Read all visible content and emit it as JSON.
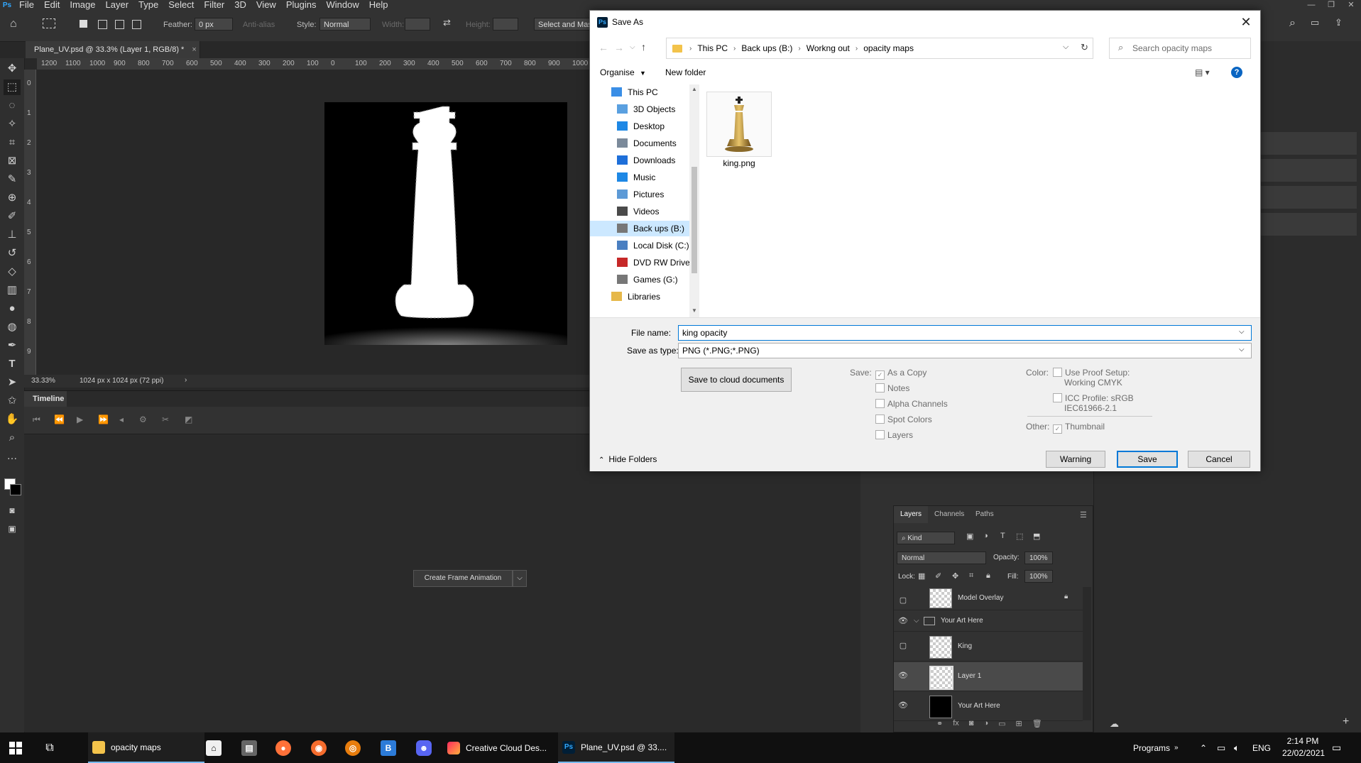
{
  "app": {
    "logo": "Ps",
    "menu": [
      "File",
      "Edit",
      "Image",
      "Layer",
      "Type",
      "Select",
      "Filter",
      "3D",
      "View",
      "Plugins",
      "Window",
      "Help"
    ],
    "window_controls": [
      "—",
      "❐",
      "✕"
    ]
  },
  "options_bar": {
    "feather_label": "Feather:",
    "feather_value": "0 px",
    "antialias_label": "Anti-alias",
    "style_label": "Style:",
    "style_value": "Normal",
    "width_label": "Width:",
    "height_label": "Height:",
    "select_mask_label": "Select and Mask..."
  },
  "document": {
    "tab_title": "Plane_UV.psd @ 33.3% (Layer 1, RGB/8) *",
    "tab_close": "×",
    "zoom": "33.33%",
    "doc_size": "1024 px x 1024 px (72 ppi)",
    "ruler_top": [
      "1200",
      "1100",
      "1000",
      "900",
      "800",
      "700",
      "600",
      "500",
      "400",
      "300",
      "200",
      "100",
      "0",
      "100",
      "200",
      "300",
      "400",
      "500",
      "600",
      "700",
      "800",
      "900",
      "1000"
    ],
    "ruler_left": [
      "0",
      "1",
      "2",
      "3",
      "4",
      "5",
      "6",
      "7",
      "8",
      "9"
    ]
  },
  "timeline": {
    "tab_label": "Timeline",
    "create_button": "Create Frame Animation",
    "dropdown_arrow": "⌵"
  },
  "layers_panel": {
    "tabs": [
      "Layers",
      "Channels",
      "Paths"
    ],
    "kind_value": "Kind",
    "blend_mode": "Normal",
    "opacity_label": "Opacity:",
    "opacity_value": "100%",
    "lock_label": "Lock:",
    "fill_label": "Fill:",
    "fill_value": "100%",
    "layers": [
      {
        "name": "Model Overlay",
        "visible": false
      },
      {
        "name": "Your Art Here",
        "visible": true,
        "group": true
      },
      {
        "name": "King",
        "visible": false
      },
      {
        "name": "Layer 1",
        "visible": true,
        "selected": true
      },
      {
        "name": "Your Art Here",
        "visible": true
      }
    ]
  },
  "dialog": {
    "icon": "Ps",
    "title": "Save As",
    "close": "✕",
    "breadcrumbs": [
      "This PC",
      "Back ups (B:)",
      "Workng out",
      "opacity maps"
    ],
    "search_placeholder": "Search opacity maps",
    "organise": "Organise",
    "new_folder": "New folder",
    "help": "?",
    "nav_tree": [
      {
        "label": "This PC",
        "color": "#3a8ee6"
      },
      {
        "label": "3D Objects",
        "color": "#5aa0e0"
      },
      {
        "label": "Desktop",
        "color": "#1e88e5"
      },
      {
        "label": "Documents",
        "color": "#7b8a9a"
      },
      {
        "label": "Downloads",
        "color": "#1e6fd9"
      },
      {
        "label": "Music",
        "color": "#1e88e5"
      },
      {
        "label": "Pictures",
        "color": "#5d9ad6"
      },
      {
        "label": "Videos",
        "color": "#4a4a4a"
      },
      {
        "label": "Back ups (B:)",
        "color": "#777777"
      },
      {
        "label": "Local Disk (C:)",
        "color": "#4a7fc1"
      },
      {
        "label": "DVD RW Drive",
        "color": "#c62828"
      },
      {
        "label": "Games (G:)",
        "color": "#777777"
      },
      {
        "label": "Libraries",
        "color": "#e6b84a"
      }
    ],
    "files": [
      {
        "name": "king.png"
      }
    ],
    "file_name_label": "File name:",
    "file_name_value": "king opacity",
    "save_type_label": "Save as type:",
    "save_type_value": "PNG (*.PNG;*.PNG)",
    "cloud_button": "Save to cloud documents",
    "save_options_label": "Save:",
    "save_options": [
      "As a Copy",
      "Notes",
      "Alpha Channels",
      "Spot Colors",
      "Layers"
    ],
    "color_label": "Color:",
    "use_proof_line1": "Use Proof Setup:",
    "use_proof_line2": "Working CMYK",
    "icc_line1": "ICC Profile:  sRGB",
    "icc_line2": "IEC61966-2.1",
    "other_label": "Other:",
    "thumbnail": "Thumbnail",
    "hide_folders": "Hide Folders",
    "warning_button": "Warning",
    "save_button": "Save",
    "cancel_button": "Cancel"
  },
  "taskbar": {
    "items": [
      {
        "label": "opacity maps"
      },
      {
        "label": "Creative Cloud Des..."
      },
      {
        "label": "Plane_UV.psd @ 33...."
      }
    ],
    "programs_label": "Programs",
    "language": "ENG",
    "time": "2:14 PM",
    "date": "22/02/2021"
  },
  "colors": {
    "ps_blue": "#31a8ff",
    "win_accent": "#0078d7",
    "dialog_bg": "#ffffff"
  }
}
